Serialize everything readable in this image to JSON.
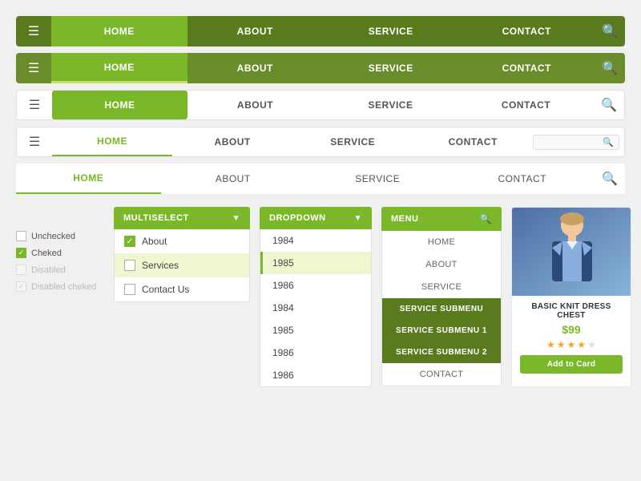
{
  "nav1": {
    "items": [
      "HOME",
      "ABOUT",
      "SERVICE",
      "CONTACT"
    ],
    "active": "HOME"
  },
  "nav2": {
    "items": [
      "HOME",
      "ABOUT",
      "SERVICE",
      "CONTACT"
    ],
    "active": "HOME"
  },
  "nav3": {
    "items": [
      "HOME",
      "ABOUT",
      "SERVICE",
      "CONTACT"
    ],
    "active": "HOME"
  },
  "nav4": {
    "items": [
      "HOME",
      "ABOUT",
      "SERVICE",
      "CONTACT"
    ],
    "active": "HOME",
    "search_placeholder": ""
  },
  "nav5": {
    "items": [
      "HOME",
      "ABOUT",
      "SERVICE",
      "CONTACT"
    ],
    "active": "HOME"
  },
  "multiselect": {
    "header": "MULTISELECT",
    "items": [
      {
        "label": "About",
        "checked": true,
        "highlighted": false
      },
      {
        "label": "Services",
        "checked": false,
        "highlighted": true
      },
      {
        "label": "Contact Us",
        "checked": false,
        "highlighted": false
      }
    ]
  },
  "dropdown": {
    "header": "DROPDOWN",
    "items": [
      {
        "label": "1984",
        "highlighted": false
      },
      {
        "label": "1985",
        "highlighted": true
      },
      {
        "label": "1986",
        "highlighted": false
      },
      {
        "label": "1984",
        "highlighted": false
      },
      {
        "label": "1985",
        "highlighted": false
      },
      {
        "label": "1986",
        "highlighted": false
      },
      {
        "label": "1986",
        "highlighted": false
      }
    ]
  },
  "menu": {
    "header": "MENU",
    "items": [
      {
        "label": "HOME",
        "type": "normal"
      },
      {
        "label": "ABOUT",
        "type": "normal"
      },
      {
        "label": "SERVICE",
        "type": "normal"
      },
      {
        "label": "SERVICE SUBMENU",
        "type": "submenu"
      },
      {
        "label": "SERVICE SUBMENU 1",
        "type": "submenu"
      },
      {
        "label": "SERVICE SUBMENU 2",
        "type": "submenu"
      },
      {
        "label": "CONTACT",
        "type": "normal"
      }
    ]
  },
  "checkboxes": {
    "items": [
      {
        "label": "Unchecked",
        "state": "unchecked"
      },
      {
        "label": "Cheked",
        "state": "checked"
      },
      {
        "label": "Disabled",
        "state": "disabled"
      },
      {
        "label": "Disabled cheked",
        "state": "disabled-checked"
      }
    ]
  },
  "product": {
    "name": "BASIC KNIT DRESS CHEST",
    "price": "$99",
    "stars": [
      true,
      true,
      true,
      true,
      false
    ],
    "add_to_card_label": "Add to Card"
  }
}
